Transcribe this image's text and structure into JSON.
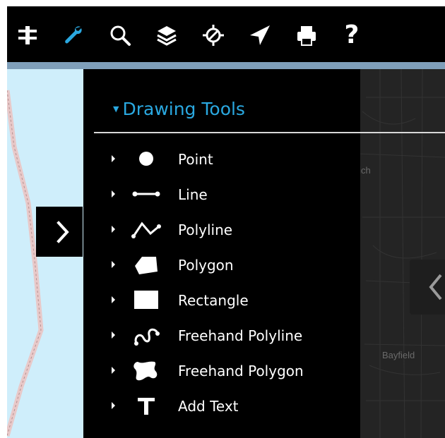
{
  "toolbar": {
    "buttons": [
      {
        "name": "legend-icon"
      },
      {
        "name": "wrench-icon",
        "active": true
      },
      {
        "name": "search-icon"
      },
      {
        "name": "layers-icon"
      },
      {
        "name": "locate-icon"
      },
      {
        "name": "send-icon"
      },
      {
        "name": "print-icon"
      },
      {
        "name": "help-icon",
        "glyph": "?"
      }
    ],
    "active_color": "#2aa8e0"
  },
  "panel": {
    "title": "Drawing Tools",
    "tools": [
      {
        "label": "Point",
        "icon": "point-icon"
      },
      {
        "label": "Line",
        "icon": "line-icon"
      },
      {
        "label": "Polyline",
        "icon": "polyline-icon"
      },
      {
        "label": "Polygon",
        "icon": "polygon-icon"
      },
      {
        "label": "Rectangle",
        "icon": "rectangle-icon"
      },
      {
        "label": "Freehand Polyline",
        "icon": "freehand-polyline-icon"
      },
      {
        "label": "Freehand Polygon",
        "icon": "freehand-polygon-icon"
      },
      {
        "label": "Add Text",
        "icon": "text-icon"
      }
    ]
  },
  "map": {
    "places": [
      "Goderich",
      "Bayfield"
    ]
  },
  "colors": {
    "accent": "#2aa8e0",
    "toolbar_bg": "#000000",
    "water": "#cfeefb"
  }
}
